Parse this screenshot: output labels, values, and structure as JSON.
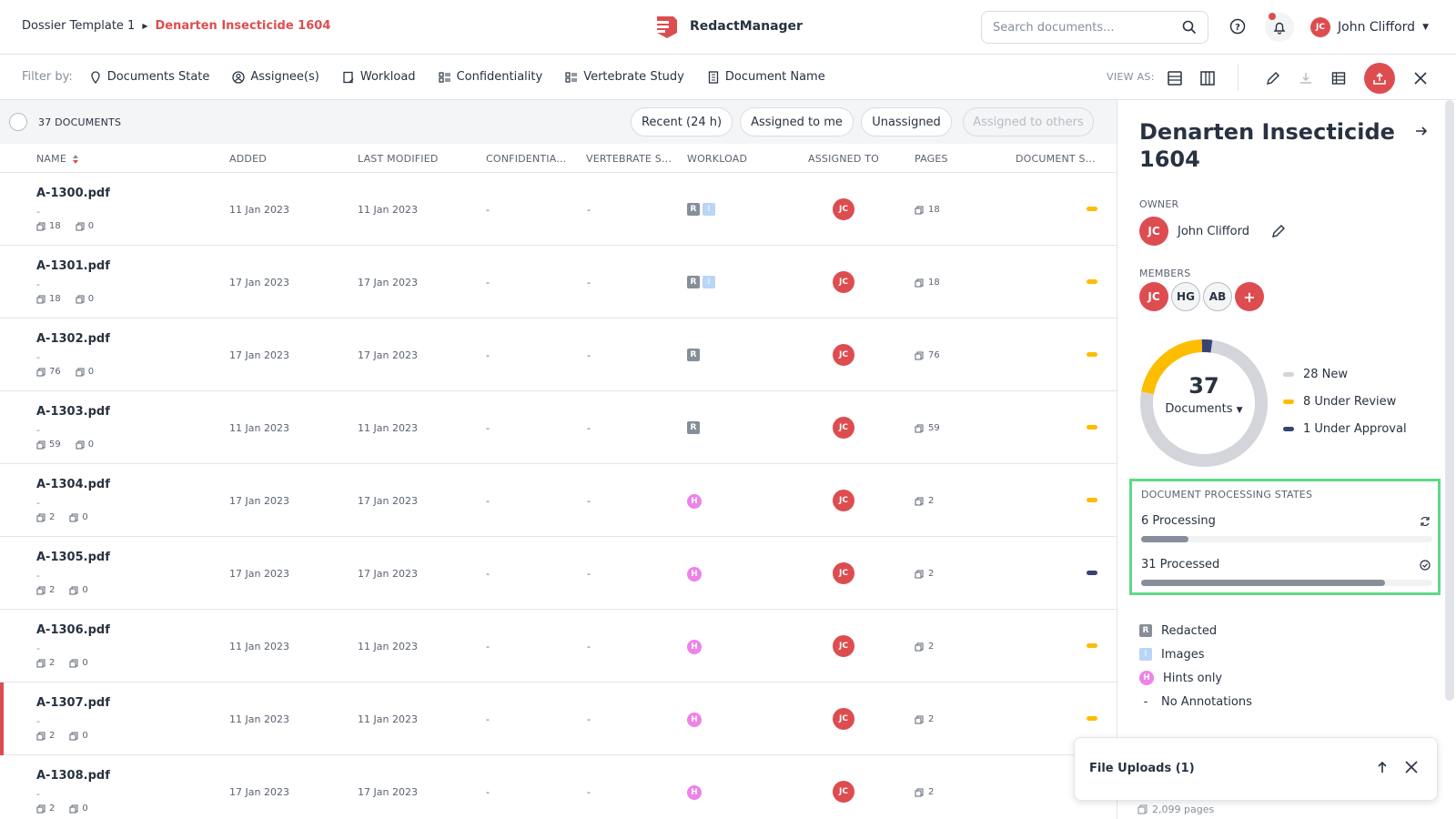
{
  "breadcrumb": {
    "parent": "Dossier Template 1",
    "current": "Denarten Insecticide 1604"
  },
  "app": {
    "name": "RedactManager"
  },
  "search": {
    "placeholder": "Search documents..."
  },
  "user": {
    "initials": "JC",
    "name": "John Clifford"
  },
  "filters": {
    "label": "Filter by:",
    "items": [
      "Documents State",
      "Assignee(s)",
      "Workload",
      "Confidentiality",
      "Vertebrate Study",
      "Document Name"
    ]
  },
  "view_as": "VIEW AS:",
  "table": {
    "count": "37 DOCUMENTS",
    "chips": [
      "Recent (24 h)",
      "Assigned to me",
      "Unassigned",
      "Assigned to others"
    ],
    "columns": [
      "NAME",
      "ADDED",
      "LAST MODIFIED",
      "CONFIDENTIA...",
      "VERTEBRATE S...",
      "WORKLOAD",
      "ASSIGNED TO",
      "PAGES",
      "DOCUMENT S..."
    ],
    "rows": [
      {
        "name": "A-1300.pdf",
        "dash": "-",
        "pages_meta": "18",
        "ann": "0",
        "added": "11 Jan 2023",
        "modified": "11 Jan 2023",
        "conf": "-",
        "vert": "-",
        "workload": [
          "R",
          "I"
        ],
        "assignee": "JC",
        "pages": "18",
        "status": "#fdbd00"
      },
      {
        "name": "A-1301.pdf",
        "dash": "-",
        "pages_meta": "18",
        "ann": "0",
        "added": "17 Jan 2023",
        "modified": "17 Jan 2023",
        "conf": "-",
        "vert": "-",
        "workload": [
          "R",
          "I"
        ],
        "assignee": "JC",
        "pages": "18",
        "status": "#fdbd00"
      },
      {
        "name": "A-1302.pdf",
        "dash": "-",
        "pages_meta": "76",
        "ann": "0",
        "added": "17 Jan 2023",
        "modified": "17 Jan 2023",
        "conf": "-",
        "vert": "-",
        "workload": [
          "R"
        ],
        "assignee": "JC",
        "pages": "76",
        "status": "#fdbd00"
      },
      {
        "name": "A-1303.pdf",
        "dash": "-",
        "pages_meta": "59",
        "ann": "0",
        "added": "11 Jan 2023",
        "modified": "11 Jan 2023",
        "conf": "-",
        "vert": "-",
        "workload": [
          "R"
        ],
        "assignee": "JC",
        "pages": "59",
        "status": "#fdbd00"
      },
      {
        "name": "A-1304.pdf",
        "dash": "-",
        "pages_meta": "2",
        "ann": "0",
        "added": "17 Jan 2023",
        "modified": "17 Jan 2023",
        "conf": "-",
        "vert": "-",
        "workload": [
          "H"
        ],
        "assignee": "JC",
        "pages": "2",
        "status": "#fdbd00"
      },
      {
        "name": "A-1305.pdf",
        "dash": "-",
        "pages_meta": "2",
        "ann": "0",
        "added": "17 Jan 2023",
        "modified": "17 Jan 2023",
        "conf": "-",
        "vert": "-",
        "workload": [
          "H"
        ],
        "assignee": "JC",
        "pages": "2",
        "status": "#374375"
      },
      {
        "name": "A-1306.pdf",
        "dash": "-",
        "pages_meta": "2",
        "ann": "0",
        "added": "11 Jan 2023",
        "modified": "11 Jan 2023",
        "conf": "-",
        "vert": "-",
        "workload": [
          "H"
        ],
        "assignee": "JC",
        "pages": "2",
        "status": "#fdbd00"
      },
      {
        "name": "A-1307.pdf",
        "dash": "-",
        "pages_meta": "2",
        "ann": "0",
        "added": "11 Jan 2023",
        "modified": "11 Jan 2023",
        "conf": "-",
        "vert": "-",
        "workload": [
          "H"
        ],
        "assignee": "JC",
        "pages": "2",
        "status": "#fdbd00",
        "selected": true
      },
      {
        "name": "A-1308.pdf",
        "dash": "-",
        "pages_meta": "2",
        "ann": "0",
        "added": "17 Jan 2023",
        "modified": "17 Jan 2023",
        "conf": "-",
        "vert": "-",
        "workload": [
          "H"
        ],
        "assignee": "JC",
        "pages": "2",
        "status": "#fdbd00"
      }
    ]
  },
  "details": {
    "title": "Denarten Insecticide 1604",
    "owner_label": "OWNER",
    "owner": {
      "initials": "JC",
      "name": "John Clifford"
    },
    "members_label": "MEMBERS",
    "members": [
      "JC",
      "HG",
      "AB"
    ],
    "add_member": "+",
    "donut": {
      "total": "37",
      "label": "Documents",
      "segments": [
        {
          "label": "28 New",
          "value": 28,
          "color": "#d3d5da"
        },
        {
          "label": "8 Under Review",
          "value": 8,
          "color": "#fdbd00"
        },
        {
          "label": "1 Under Approval",
          "value": 1,
          "color": "#374375"
        }
      ]
    },
    "processing": {
      "label": "DOCUMENT PROCESSING STATES",
      "processing": "6 Processing",
      "processing_value": 6,
      "processed": "31 Processed",
      "processed_value": 31,
      "total": 37
    },
    "keys": [
      {
        "mark": "R",
        "label": "Redacted"
      },
      {
        "mark": "I",
        "label": "Images"
      },
      {
        "mark": "H",
        "label": "Hints only"
      },
      {
        "mark": "-",
        "label": "No Annotations"
      }
    ],
    "pages_total": "2,099 pages"
  },
  "uploads": {
    "title": "File Uploads (1)"
  },
  "colors": {
    "accent": "#dd4d50",
    "review": "#fdbd00",
    "approval": "#374375",
    "new": "#d3d5da",
    "highlight": "#5fd886"
  }
}
